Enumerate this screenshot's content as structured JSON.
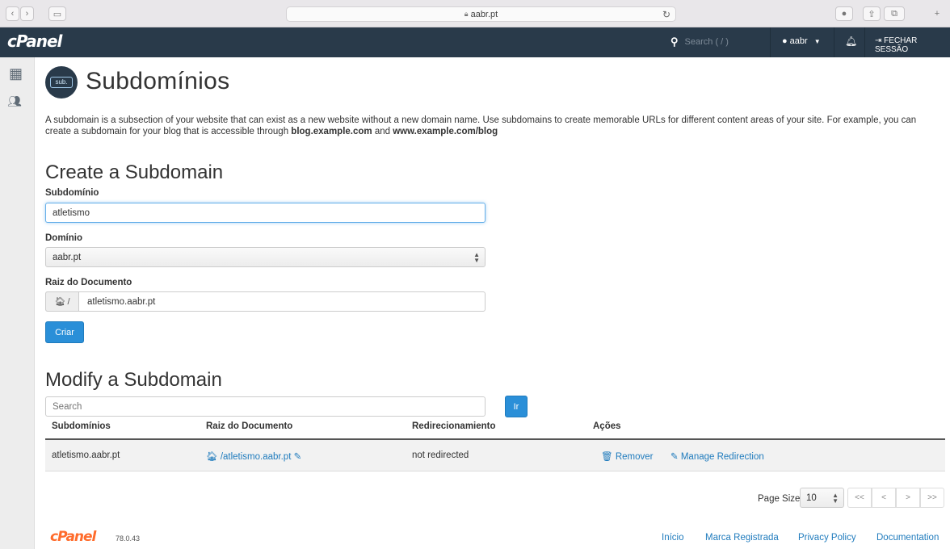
{
  "browser": {
    "url": "aabr.pt"
  },
  "header": {
    "logo": "cPanel",
    "search_placeholder": "Search ( / )",
    "user": "aabr",
    "logout": "FECHAR SESSÃO"
  },
  "page": {
    "icon_text": "sub.",
    "title": "Subdomínios",
    "intro_part1": "A subdomain is a subsection of your website that can exist as a new website without a new domain name. Use subdomains to create memorable URLs for different content areas of your site. For example, you can create a subdomain for your blog that is accessible through ",
    "intro_link1": "blog.example.com",
    "intro_and": " and ",
    "intro_link2": "www.example.com/blog"
  },
  "create": {
    "heading": "Create a Subdomain",
    "subdomain_label": "Subdomínio",
    "subdomain_value": "atletismo",
    "domain_label": "Domínio",
    "domain_value": "aabr.pt",
    "docroot_label": "Raiz do Documento",
    "docroot_prefix": "/",
    "docroot_value": "atletismo.aabr.pt",
    "submit": "Criar"
  },
  "modify": {
    "heading": "Modify a Subdomain",
    "search_placeholder": "Search",
    "go": "Ir",
    "columns": [
      "Subdomínios",
      "Raiz do Documento",
      "Redirecionamiento",
      "Ações"
    ],
    "rows": [
      {
        "subdomain": "atletismo.aabr.pt",
        "docroot": "/atletismo.aabr.pt",
        "redirect": "not redirected",
        "remove": "Remover",
        "manage": "Manage Redirection"
      }
    ]
  },
  "pagination": {
    "page_size_label": "Page Size",
    "page_size": "10",
    "first": "<<",
    "prev": "<",
    "next": ">",
    "last": ">>"
  },
  "footer": {
    "logo": "cPanel",
    "version": "78.0.43",
    "links": [
      "Início",
      "Marca Registrada",
      "Privacy Policy",
      "Documentation"
    ]
  }
}
